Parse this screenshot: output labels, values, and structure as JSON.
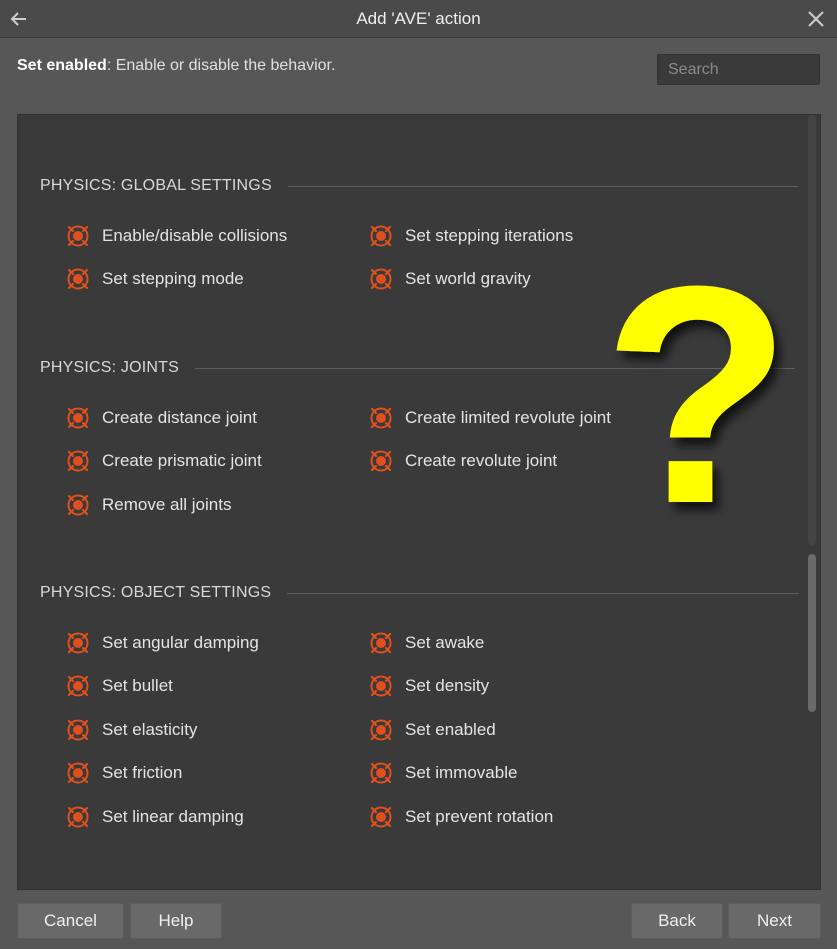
{
  "window": {
    "title": "Add 'AVE' action"
  },
  "description": {
    "bold": "Set enabled",
    "text": ": Enable or disable the behavior."
  },
  "search": {
    "placeholder": "Search",
    "value": ""
  },
  "sections": [
    {
      "title": "PHYSICS: GLOBAL SETTINGS",
      "items": [
        "Enable/disable collisions",
        "Set stepping iterations",
        "Set stepping mode",
        "Set world gravity"
      ]
    },
    {
      "title": "PHYSICS: JOINTS",
      "items": [
        "Create distance joint",
        "Create limited revolute joint",
        "Create prismatic joint",
        "Create revolute joint",
        "Remove all joints"
      ]
    },
    {
      "title": "PHYSICS: OBJECT SETTINGS",
      "items": [
        "Set angular damping",
        "Set awake",
        "Set bullet",
        "Set density",
        "Set elasticity",
        "Set enabled",
        "Set friction",
        "Set immovable",
        "Set linear damping",
        "Set prevent rotation"
      ]
    }
  ],
  "overlay": {
    "glyph": "?",
    "color": "#ffff00"
  },
  "buttons": {
    "cancel": "Cancel",
    "help": "Help",
    "back": "Back",
    "next": "Next"
  },
  "colors": {
    "icon_accent": "#e0501e",
    "panel_bg": "#3a3a3a"
  }
}
